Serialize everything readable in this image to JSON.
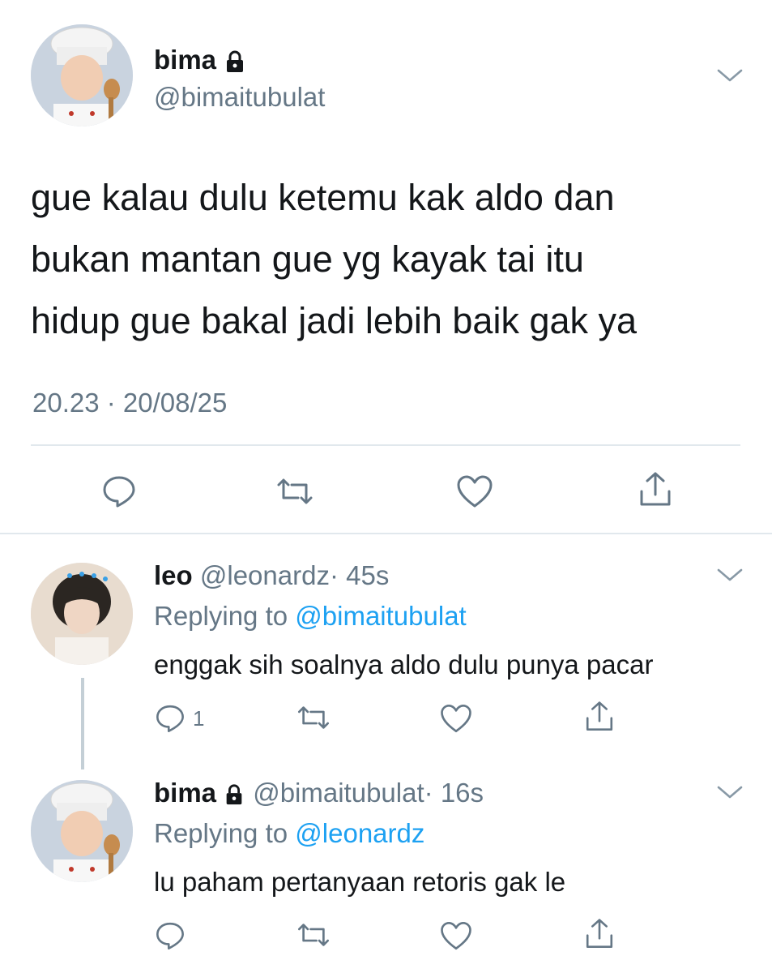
{
  "main_tweet": {
    "display_name": "bima",
    "handle": "@bimaitubulat",
    "text_lines": [
      "gue kalau dulu ketemu kak aldo dan",
      "bukan mantan gue yg kayak tai itu",
      "hidup gue bakal jadi lebih baik gak ya"
    ],
    "timestamp": "20.23 · 20/08/25",
    "avatar_icon": "chef-avatar",
    "locked_icon": "lock-icon"
  },
  "replies": [
    {
      "display_name": "leo",
      "handle": "@leonardz",
      "time": "· 45s",
      "replying_prefix": "Replying to",
      "replying_handle": "@bimaitubulat",
      "text": "enggak sih soalnya aldo dulu punya pacar",
      "reply_count": "1",
      "avatar_icon": "leo-avatar"
    },
    {
      "display_name": "bima",
      "handle": "@bimaitubulat",
      "time": "· 16s",
      "replying_prefix": "Replying to",
      "replying_handle": "@leonardz",
      "text": "lu paham pertanyaan retoris gak le",
      "reply_count": "",
      "avatar_icon": "chef-avatar"
    }
  ],
  "colors": {
    "text": "#14171a",
    "muted": "#657786",
    "link": "#1da1f2",
    "divider": "#e1e8ed"
  }
}
